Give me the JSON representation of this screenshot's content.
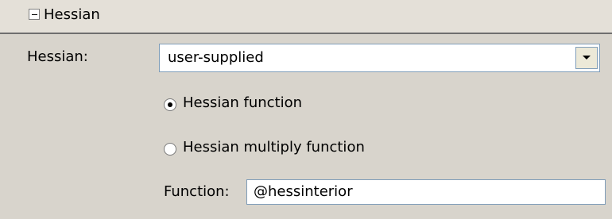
{
  "section": {
    "title": "Hessian"
  },
  "fields": {
    "hessian_label": "Hessian:",
    "hessian_select_value": "user-supplied",
    "radio_options": [
      {
        "label": "Hessian function",
        "checked": true
      },
      {
        "label": "Hessian multiply function",
        "checked": false
      }
    ],
    "function_label": "Function:",
    "function_value": "@hessinterior"
  },
  "icons": {
    "collapse": "minus-box-icon",
    "dropdown": "chevron-down-icon",
    "radio": "radio-icon"
  },
  "colors": {
    "panel_background": "#d8d4cc",
    "header_background": "#e4e0d8",
    "field_border": "#7f9db9",
    "field_background": "#ffffff"
  }
}
